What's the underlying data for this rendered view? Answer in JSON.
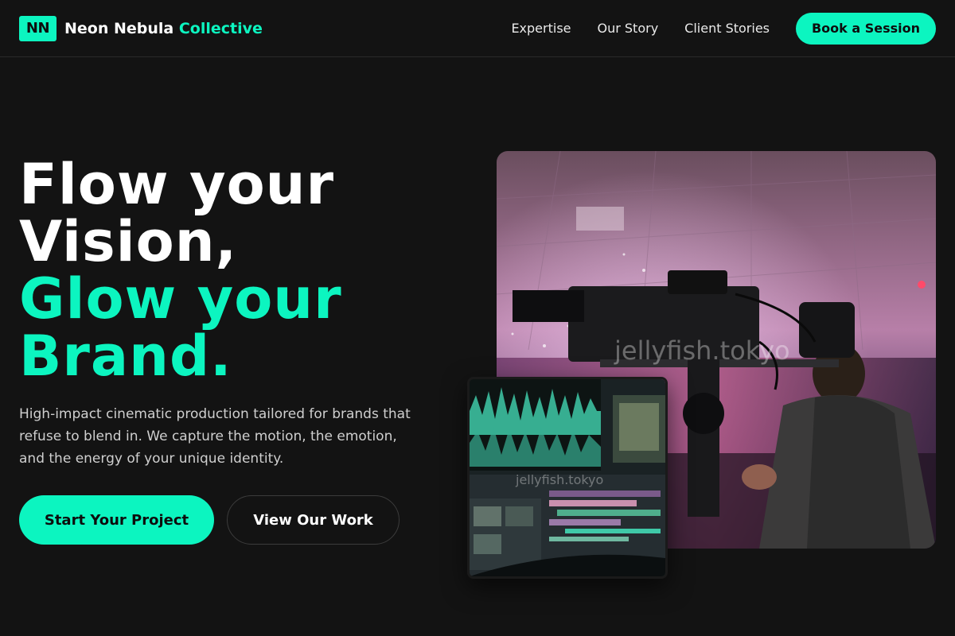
{
  "header": {
    "logo_badge": "NN",
    "brand_name": "Neon Nebula",
    "brand_accent": "Collective",
    "nav": [
      "Expertise",
      "Our Story",
      "Client Stories"
    ],
    "cta_label": "Book a Session"
  },
  "hero": {
    "title_line1": "Flow your",
    "title_line2": "Vision,",
    "title_line3": "Glow your",
    "title_line4": "Brand.",
    "description": "High-impact cinematic production tailored for brands that refuse to blend in. We capture the motion, the emotion, and the energy of your unique identity.",
    "primary_button": "Start Your Project",
    "secondary_button": "View Our Work"
  },
  "media": {
    "main_watermark": "jellyfish.tokyo",
    "inset_watermark": "jellyfish.tokyo"
  },
  "colors": {
    "accent": "#0cf5c0",
    "background": "#131313"
  }
}
